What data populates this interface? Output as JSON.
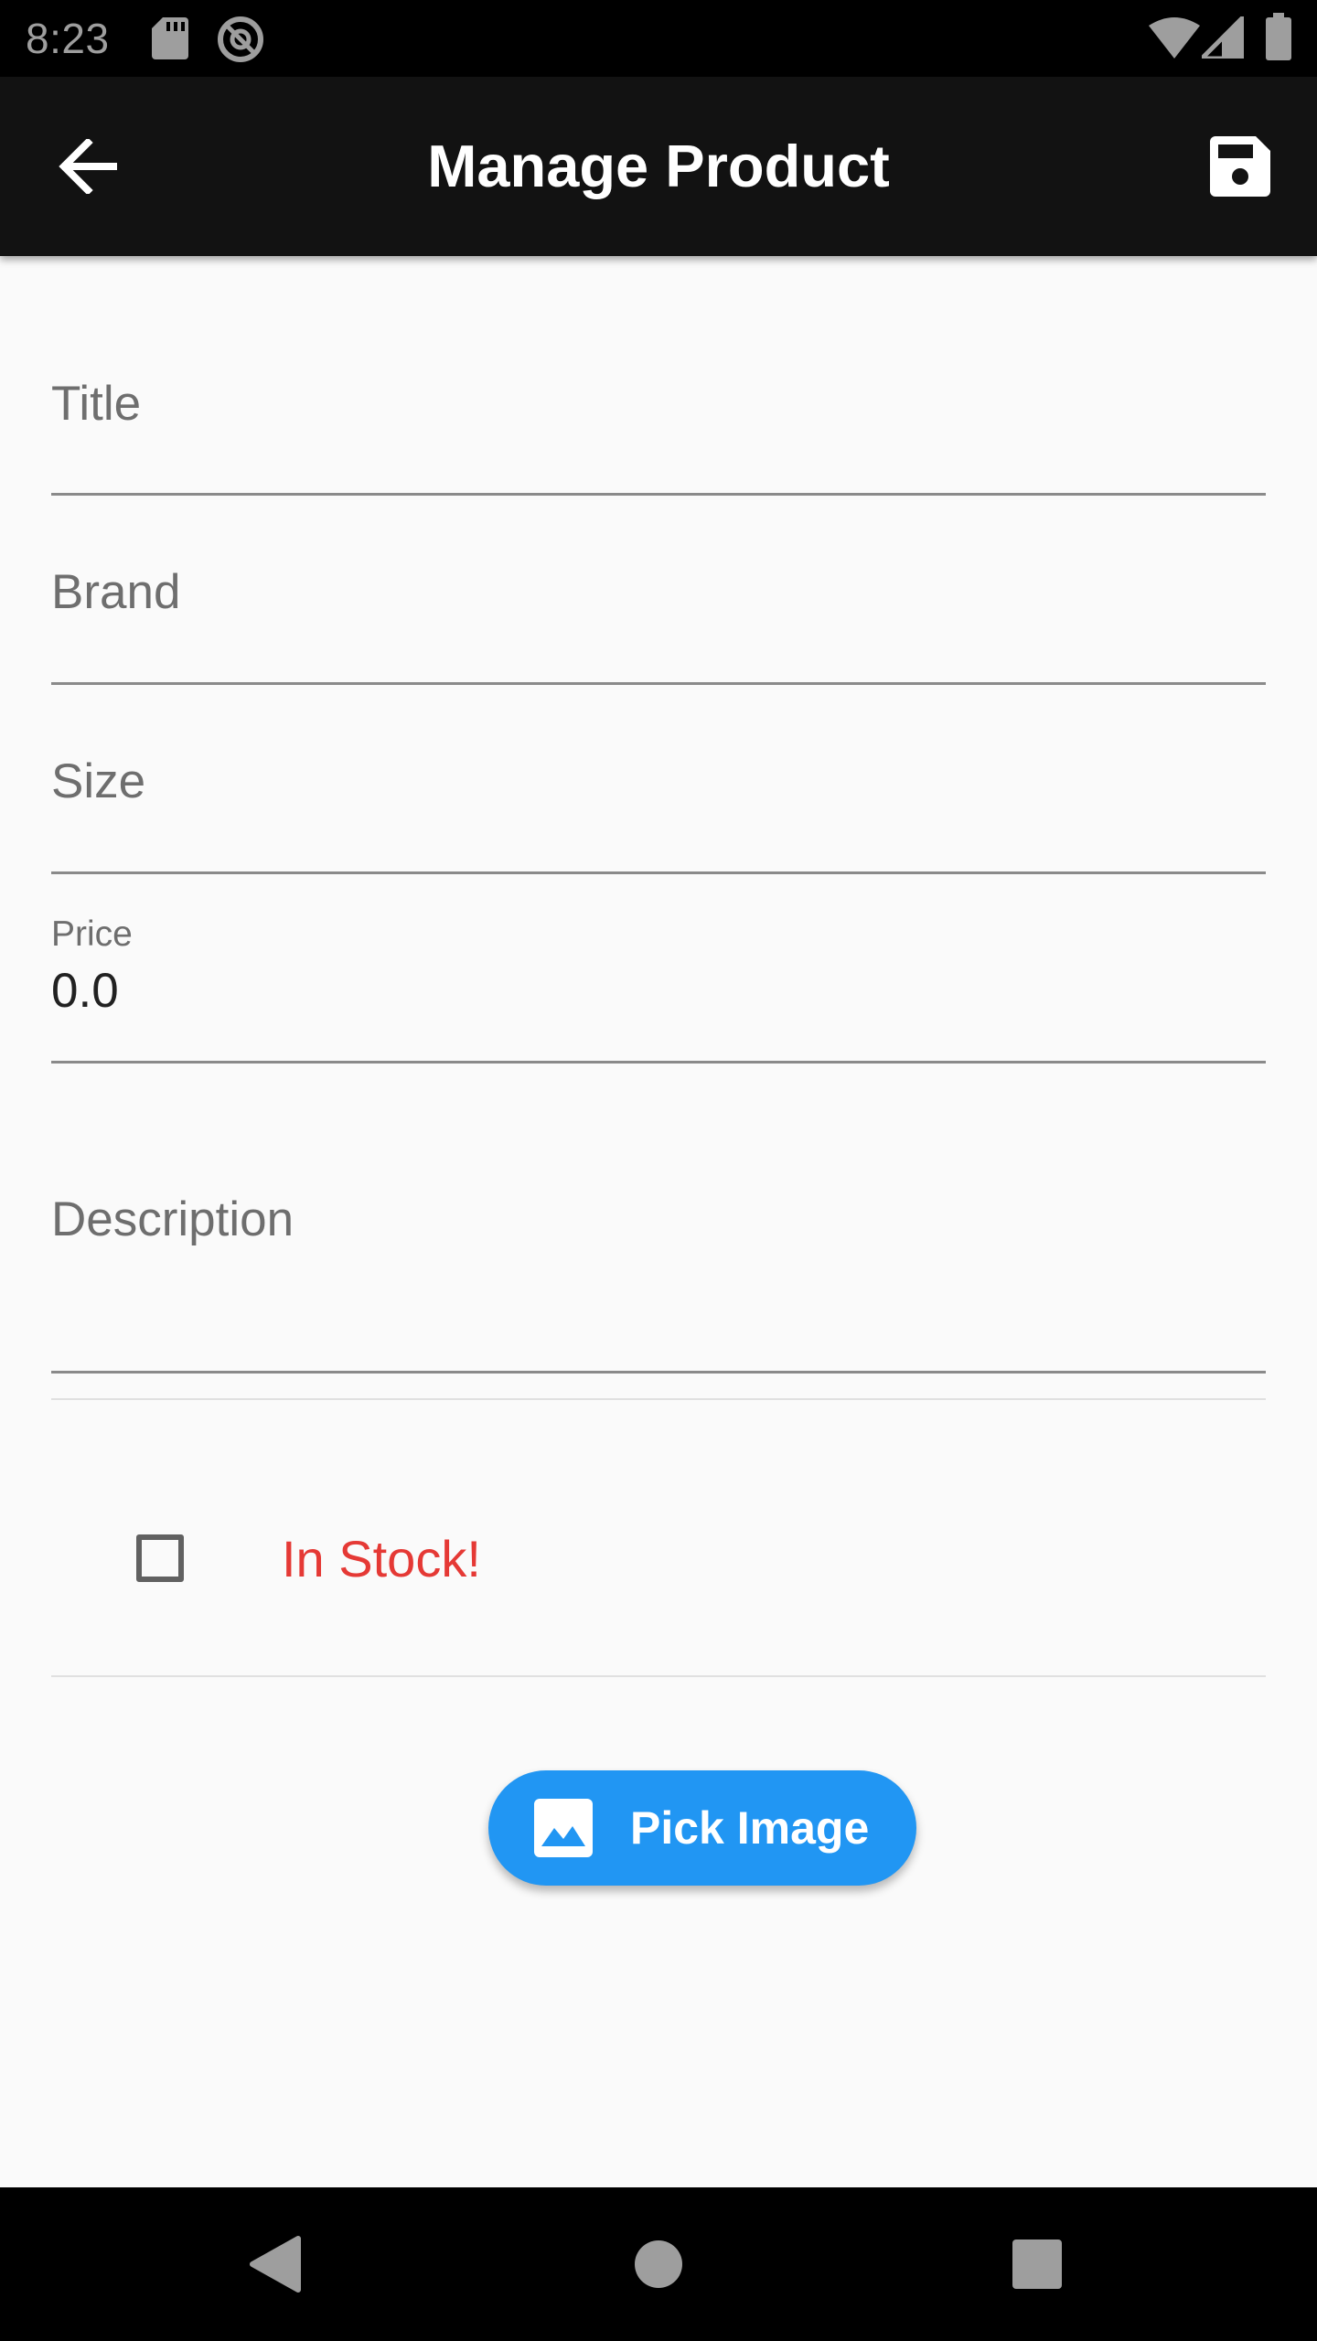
{
  "status_bar": {
    "time": "8:23",
    "icons": [
      "sd-card-icon",
      "data-saver-icon",
      "wifi-icon",
      "cell-signal-icon",
      "battery-icon"
    ]
  },
  "app_bar": {
    "title": "Manage Product",
    "back_icon": "arrow-back-icon",
    "save_icon": "save-icon",
    "background": "#121212"
  },
  "form": {
    "title": {
      "label": "Title",
      "value": ""
    },
    "brand": {
      "label": "Brand",
      "value": ""
    },
    "size": {
      "label": "Size",
      "value": ""
    },
    "price": {
      "label": "Price",
      "value": "0.0"
    },
    "description": {
      "label": "Description",
      "value": ""
    }
  },
  "stock": {
    "label": "In Stock!",
    "checked": false,
    "label_color": "#e53935"
  },
  "pick_image": {
    "label": "Pick Image",
    "icon": "image-icon",
    "color": "#2196f3"
  },
  "nav_bar": {
    "buttons": [
      "back-triangle-icon",
      "home-circle-icon",
      "recents-square-icon"
    ]
  }
}
